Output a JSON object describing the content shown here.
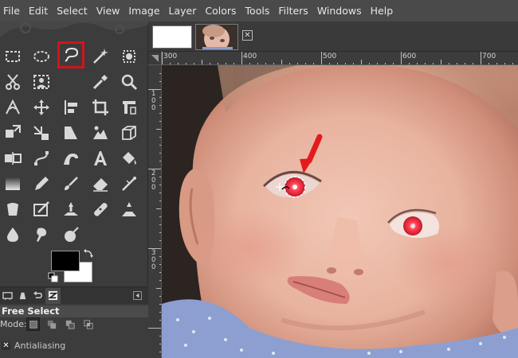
{
  "menubar": {
    "items": [
      "File",
      "Edit",
      "Select",
      "View",
      "Image",
      "Layer",
      "Colors",
      "Tools",
      "Filters",
      "Windows",
      "Help"
    ]
  },
  "toolbox": {
    "tools": [
      "rect-select-icon",
      "ellipse-select-icon",
      "free-select-icon",
      "fuzzy-select-icon",
      "select-by-color-icon",
      "scissors-select-icon",
      "foreground-select-icon",
      "color-picker-icon",
      "zoom-icon",
      "measure-icon",
      "move-icon",
      "align-icon",
      "crop-icon",
      "rotate-icon",
      "scale-icon",
      "shear-icon",
      "perspective-icon",
      "flip-icon",
      "cage-icon",
      "unified-transform-icon",
      "paths-icon",
      "warp-icon",
      "text-icon",
      "bucket-fill-icon",
      "gradient-icon",
      "pencil-icon",
      "paintbrush-icon",
      "eraser-icon",
      "airbrush-icon",
      "ink-icon",
      "mypaint-brush-icon",
      "clone-icon",
      "heal-icon",
      "perspective-clone-icon",
      "blur-icon",
      "smudge-icon",
      "dodge-burn-icon"
    ],
    "active_tool": "free-select-icon",
    "foreground_color": "#000000",
    "background_color": "#ffffff"
  },
  "tool_options": {
    "title": "Free Select",
    "mode_label": "Mode:",
    "antialiasing_label": "Antialiasing",
    "antialiasing_checked_glyph": "✕"
  },
  "tabs": {
    "close_glyph": "✕"
  },
  "rulers": {
    "horizontal": [
      "300",
      "400",
      "500",
      "600",
      "700"
    ],
    "vertical": [
      "100",
      "200",
      "300"
    ]
  },
  "colors": {
    "accent_highlight": "#d3141b",
    "annotation_arrow": "#e31b1b",
    "red_eye": "#ff3b4e"
  }
}
